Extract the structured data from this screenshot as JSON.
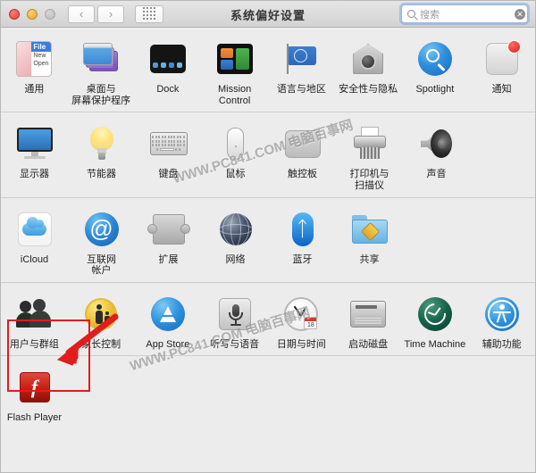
{
  "window": {
    "title": "系统偏好设置",
    "traffic_lights": [
      {
        "name": "close",
        "color": "#e0443e"
      },
      {
        "name": "minimize",
        "color": "#e1a236"
      },
      {
        "name": "zoom",
        "color": "#bcbcbc"
      }
    ],
    "nav": {
      "back_label": "‹",
      "forward_label": "›",
      "grid_label": "grid-view"
    },
    "search": {
      "placeholder": "搜索",
      "value": "",
      "clear_label": "✕"
    }
  },
  "rows": [
    {
      "id": "row-personal",
      "items": [
        {
          "label": "通用",
          "icon": "general-icon"
        },
        {
          "label": "桌面与\n屏幕保护程序",
          "label_line1": "桌面与",
          "label_line2": "屏幕保护程序",
          "icon": "desktop-screensaver-icon"
        },
        {
          "label": "Dock",
          "icon": "dock-icon"
        },
        {
          "label": "Mission\nControl",
          "label_line1": "Mission",
          "label_line2": "Control",
          "icon": "mission-control-icon"
        },
        {
          "label": "语言与地区",
          "icon": "language-region-icon"
        },
        {
          "label": "安全性与隐私",
          "icon": "security-privacy-icon"
        },
        {
          "label": "Spotlight",
          "icon": "spotlight-icon"
        },
        {
          "label": "通知",
          "icon": "notifications-icon"
        }
      ]
    },
    {
      "id": "row-hardware",
      "items": [
        {
          "label": "显示器",
          "icon": "displays-icon"
        },
        {
          "label": "节能器",
          "icon": "energy-saver-icon"
        },
        {
          "label": "键盘",
          "icon": "keyboard-icon"
        },
        {
          "label": "鼠标",
          "icon": "mouse-icon"
        },
        {
          "label": "触控板",
          "icon": "trackpad-icon"
        },
        {
          "label": "打印机与\n扫描仪",
          "label_line1": "打印机与",
          "label_line2": "扫描仪",
          "icon": "printers-scanners-icon"
        },
        {
          "label": "声音",
          "icon": "sound-icon"
        }
      ]
    },
    {
      "id": "row-internet",
      "items": [
        {
          "label": "iCloud",
          "icon": "icloud-icon"
        },
        {
          "label": "互联网\n帐户",
          "label_line1": "互联网",
          "label_line2": "帐户",
          "icon": "internet-accounts-icon"
        },
        {
          "label": "扩展",
          "icon": "extensions-icon"
        },
        {
          "label": "网络",
          "icon": "network-icon"
        },
        {
          "label": "蓝牙",
          "icon": "bluetooth-icon"
        },
        {
          "label": "共享",
          "icon": "sharing-icon"
        }
      ]
    },
    {
      "id": "row-system",
      "items": [
        {
          "label": "用户与群组",
          "icon": "users-groups-icon",
          "highlighted": true
        },
        {
          "label": "家长控制",
          "icon": "parental-controls-icon"
        },
        {
          "label": "App Store",
          "icon": "app-store-icon"
        },
        {
          "label": "听写与语音",
          "icon": "dictation-speech-icon"
        },
        {
          "label": "日期与时间",
          "icon": "date-time-icon"
        },
        {
          "label": "启动磁盘",
          "icon": "startup-disk-icon"
        },
        {
          "label": "Time Machine",
          "icon": "time-machine-icon"
        },
        {
          "label": "辅助功能",
          "icon": "accessibility-icon"
        }
      ]
    },
    {
      "id": "row-other",
      "items": [
        {
          "label": "Flash Player",
          "icon": "flash-player-icon"
        }
      ]
    }
  ],
  "annotations": {
    "highlight_color": "#e11d1d",
    "arrow_color": "#e11d1d",
    "arrow_target": "用户与群组",
    "clock_day": "18"
  },
  "watermarks": [
    {
      "text": "WWW.PC841.COM 电脑百事网"
    },
    {
      "text": "WWW.PC841.COM 电脑百事网"
    }
  ]
}
